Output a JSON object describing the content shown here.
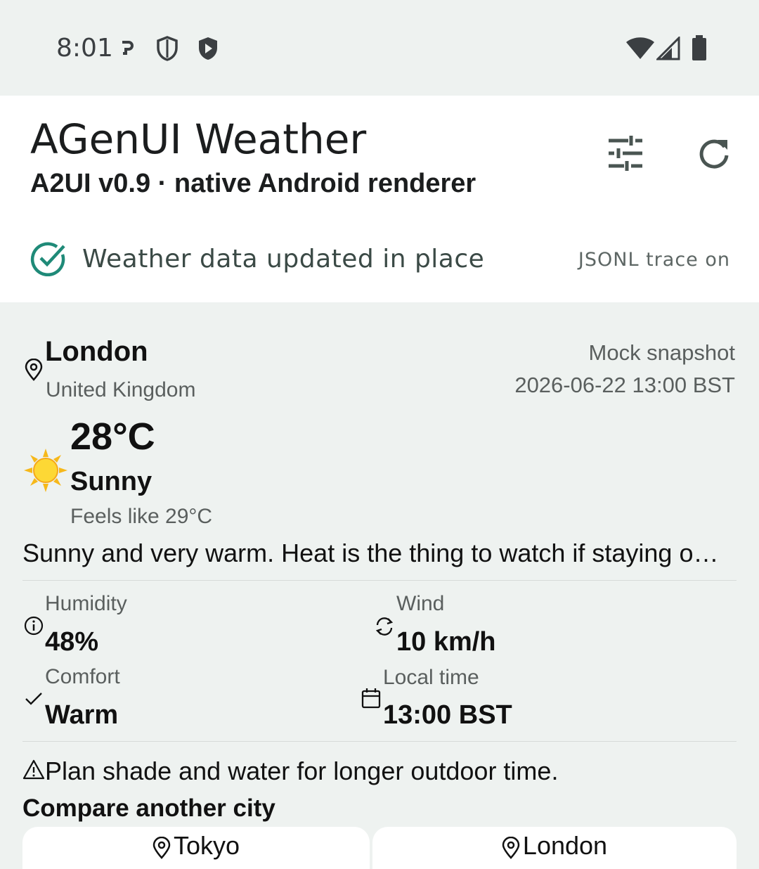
{
  "status_bar": {
    "time": "8:01",
    "icons": [
      "key-icon",
      "shield-icon",
      "play-shield-icon",
      "wifi-icon",
      "signal-icon",
      "battery-icon"
    ]
  },
  "header": {
    "title": "AGenUI Weather",
    "subtitle": "A2UI v0.9 · native Android renderer",
    "actions": [
      "tune-icon",
      "refresh-icon"
    ],
    "status_message": "Weather data updated in place",
    "trace_label": "JSONL trace on"
  },
  "weather": {
    "city": "London",
    "country": "United Kingdom",
    "snapshot_label": "Mock snapshot",
    "snapshot_time": "2026-06-22 13:00 BST",
    "temperature": "28°C",
    "condition": "Sunny",
    "feels_like": "Feels like 29°C",
    "summary": "Sunny and very warm. Heat is the thing to watch if staying outdoors for long.",
    "metrics": {
      "humidity_label": "Humidity",
      "humidity_value": "48%",
      "wind_label": "Wind",
      "wind_value": "10 km/h",
      "comfort_label": "Comfort",
      "comfort_value": "Warm",
      "local_time_label": "Local time",
      "local_time_value": "13:00 BST"
    },
    "advice": "Plan shade and water for longer outdoor time."
  },
  "compare": {
    "title": "Compare another city",
    "cities": [
      "Tokyo",
      "London"
    ]
  },
  "colors": {
    "accent": "#1f8a78",
    "icon_gray": "#4a5552",
    "sun": "#f6b81a"
  }
}
